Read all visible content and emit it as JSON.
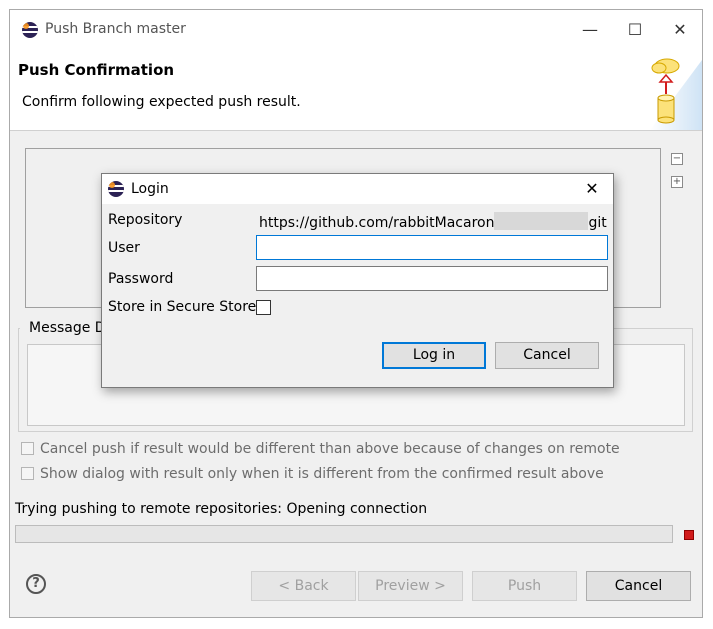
{
  "window": {
    "title": "Push Branch master",
    "minimize_icon": "minimize-icon",
    "maximize_icon": "maximize-icon",
    "close_icon": "close-icon"
  },
  "header": {
    "title": "Push Confirmation",
    "subtitle": "Confirm following expected push result."
  },
  "message_group": {
    "label": "Message D"
  },
  "options": {
    "cancel_if_different": "Cancel push if result would be different than above because of changes on remote",
    "show_dialog_only_if_different": "Show dialog with result only when it is different from the confirmed result above"
  },
  "status": {
    "text": "Trying pushing to remote repositories: Opening connection"
  },
  "buttons": {
    "back": "< Back",
    "preview": "Preview >",
    "push": "Push",
    "cancel": "Cancel",
    "help": "?"
  },
  "login": {
    "title": "Login",
    "repository_label": "Repository",
    "repository_value_start": "https://github.com/rabbitMacaron",
    "repository_value_end": "git",
    "user_label": "User",
    "user_value": "",
    "password_label": "Password",
    "password_value": "",
    "store_label": "Store in Secure Store",
    "login_button": "Log in",
    "cancel_button": "Cancel"
  },
  "colors": {
    "accent_focus": "#0078d7",
    "stop": "#d11a1a",
    "window_bg": "#f0f0f0"
  }
}
